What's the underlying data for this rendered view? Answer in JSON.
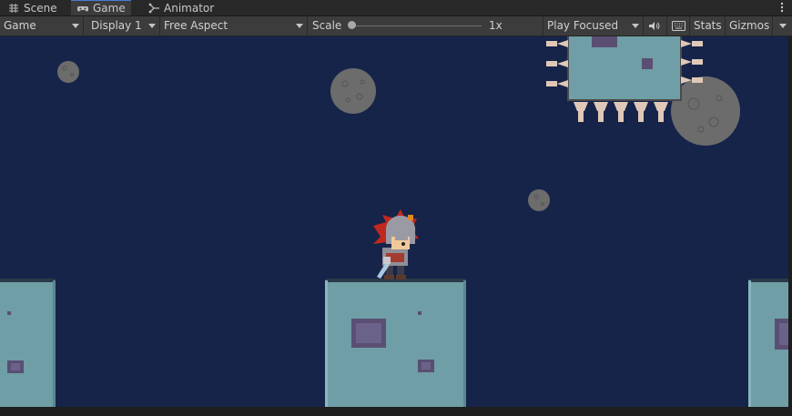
{
  "tabs": [
    {
      "label": "Scene",
      "icon": "grid-icon"
    },
    {
      "label": "Game",
      "icon": "gamepad-icon",
      "active": true
    },
    {
      "label": "Animator",
      "icon": "animator-icon"
    }
  ],
  "toolbar": {
    "display_mode": "Game",
    "display": "Display 1",
    "aspect": "Free Aspect",
    "scale_label": "Scale",
    "scale_value": "1x",
    "scale_fraction": 0.0,
    "play_mode": "Play Focused",
    "stats_label": "Stats",
    "gizmos_label": "Gizmos"
  },
  "viewport": {
    "background": "#16244a",
    "platform_color": "#6f9ea6",
    "rock_color": "#6c6c6c"
  }
}
